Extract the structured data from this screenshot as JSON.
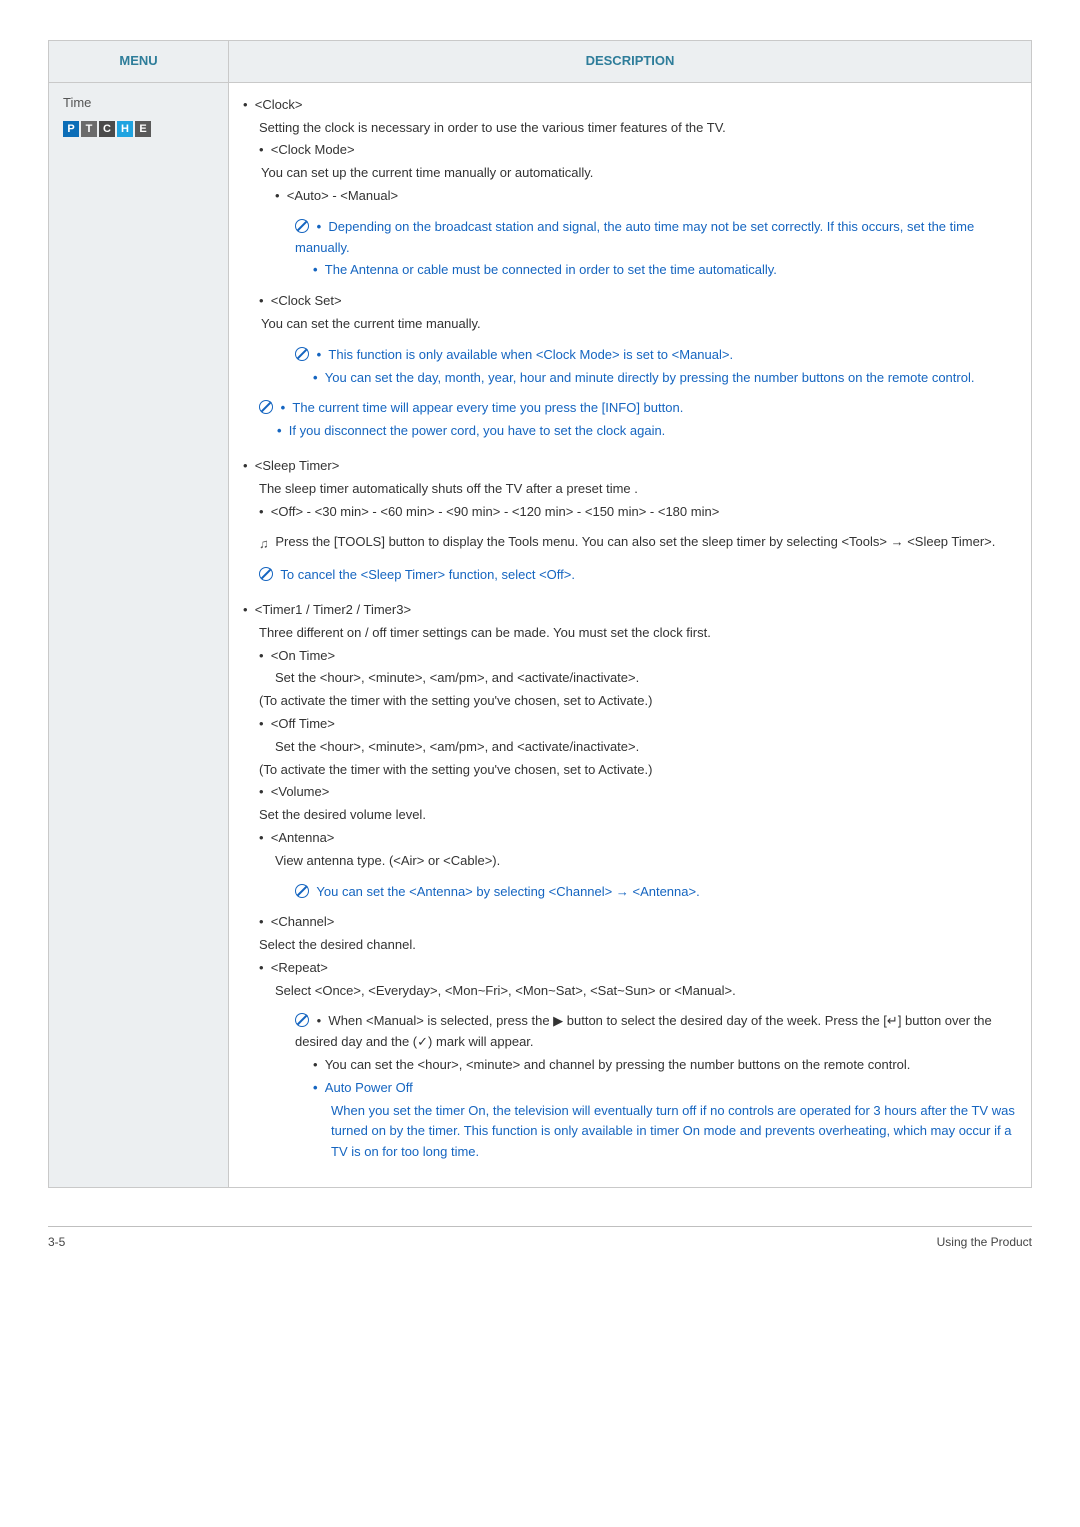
{
  "header": {
    "menu": "MENU",
    "description": "DESCRIPTION"
  },
  "menu": {
    "title": "Time",
    "badges": [
      "P",
      "T",
      "C",
      "H",
      "E"
    ]
  },
  "content": {
    "clock": {
      "title": "<Clock>",
      "intro": "Setting the clock is necessary in order to use the various timer features of the TV.",
      "mode": {
        "title": "<Clock Mode>",
        "desc": "You can set up the current time manually or automatically.",
        "options": "<Auto> - <Manual>",
        "note1": "Depending on the broadcast station and signal, the auto time may not be set correctly. If this occurs, set the time manually.",
        "note2": "The Antenna or cable must be connected in order to set the time automatically."
      },
      "set": {
        "title": "<Clock Set>",
        "desc": "You can set the current time manually.",
        "note1": "This function is only available when <Clock Mode> is set to <Manual>.",
        "note2": "You can set the day, month, year, hour and minute directly by pressing the number buttons on the remote control."
      },
      "info1": "The current time will appear every time you press the [INFO] button.",
      "info2": "If you disconnect the power cord, you have to set the clock again."
    },
    "sleep": {
      "title": "<Sleep Timer>",
      "desc": "The sleep timer automatically shuts off the TV after a preset time .",
      "options": "<Off> - <30 min> - <60 min> - <90 min> - <120 min> - <150 min> - <180 min>",
      "tools": "Press the [TOOLS] button to display the Tools menu. You can also set the sleep timer by selecting <Tools> → <Sleep Timer>.",
      "cancel": "To cancel the <Sleep Timer> function, select <Off>."
    },
    "timer": {
      "title": "<Timer1 / Timer2 / Timer3>",
      "intro": "Three different on / off timer settings can be made. You must set the clock first.",
      "ontime": {
        "title": "<On Time>",
        "l1": "Set the <hour>, <minute>, <am/pm>, and <activate/inactivate>.",
        "l2": "(To activate the timer with the setting you've chosen, set to Activate.)"
      },
      "offtime": {
        "title": "<Off Time>",
        "l1": "Set the <hour>, <minute>, <am/pm>, and <activate/inactivate>.",
        "l2": "(To activate the timer with the setting you've chosen, set to Activate.)"
      },
      "volume": {
        "title": "<Volume>",
        "desc": "Set the desired volume level."
      },
      "antenna": {
        "title": "<Antenna>",
        "desc": "View antenna type. (<Air> or <Cable>).",
        "note": "You can set the <Antenna> by selecting <Channel> → <Antenna>."
      },
      "channel": {
        "title": "<Channel>",
        "desc": "Select the desired channel."
      },
      "repeat": {
        "title": "<Repeat>",
        "desc": "Select <Once>, <Everyday>, <Mon~Fri>, <Mon~Sat>, <Sat~Sun> or <Manual>.",
        "note1a": "When <Manual> is selected, press the ▶ button to select the desired day of the week. Press the [",
        "note1b": "] button over the desired day and the (",
        "note1c": ") mark will appear.",
        "note2": "You can set the <hour>, <minute> and channel by pressing the number buttons on the remote control.",
        "apo_title": "Auto Power Off",
        "apo_desc": "When you set the timer On, the television will eventually turn off if no controls are operated for 3 hours after the TV was turned on by the timer. This function is only available in timer On mode and prevents overheating, which may occur if a TV is on for too long time."
      }
    }
  },
  "footer": {
    "left": "3-5",
    "right": "Using the Product"
  },
  "icons": {
    "enter": "↵",
    "check": "✓",
    "tools": "♫"
  }
}
